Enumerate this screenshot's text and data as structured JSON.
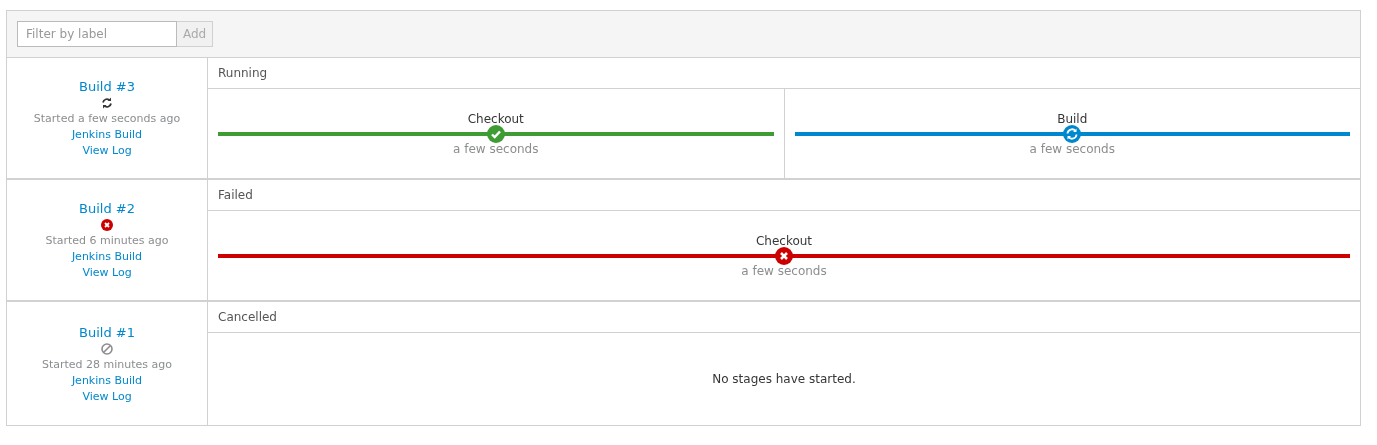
{
  "filter": {
    "placeholder": "Filter by label",
    "add_button": "Add"
  },
  "builds": [
    {
      "title": "Build #3",
      "kind": "running",
      "started": "Started a few seconds ago",
      "link": "Jenkins Build",
      "log": "View Log",
      "phase": "Running",
      "stages": [
        {
          "name": "Checkout",
          "kind": "success",
          "duration": "a few seconds"
        },
        {
          "name": "Build",
          "kind": "running",
          "duration": "a few seconds"
        }
      ]
    },
    {
      "title": "Build #2",
      "kind": "failed",
      "started": "Started 6 minutes ago",
      "link": "Jenkins Build",
      "log": "View Log",
      "phase": "Failed",
      "stages": [
        {
          "name": "Checkout",
          "kind": "failed",
          "duration": "a few seconds"
        }
      ]
    },
    {
      "title": "Build #1",
      "kind": "cancelled",
      "started": "Started 28 minutes ago",
      "link": "Jenkins Build",
      "log": "View Log",
      "phase": "Cancelled",
      "empty_message": "No stages have started."
    }
  ]
}
